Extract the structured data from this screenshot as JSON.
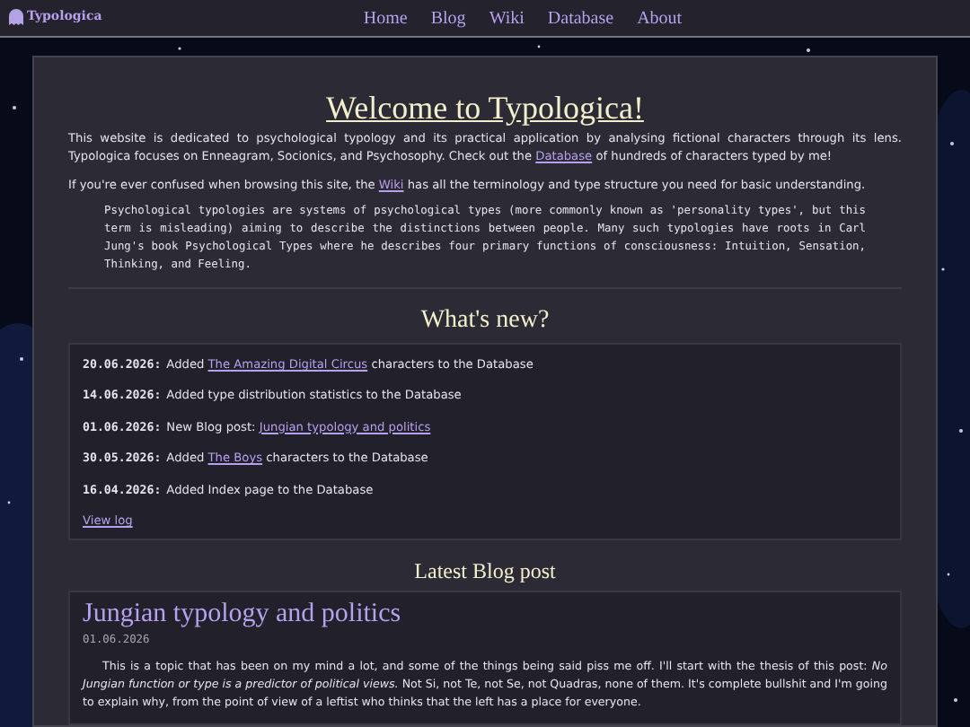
{
  "site": {
    "logo_text": "Typologica"
  },
  "nav": [
    {
      "label": "Home"
    },
    {
      "label": "Blog"
    },
    {
      "label": "Wiki"
    },
    {
      "label": "Database"
    },
    {
      "label": "About"
    }
  ],
  "welcome": {
    "title": "Welcome to Typologica!",
    "intro": {
      "before": "This website is dedicated to psychological typology and its practical application by analysing fictional characters through its lens. Typologica focuses on Enneagram, Socionics, and Psychosophy. Check out the ",
      "link": "Database",
      "after": " of hundreds of characters typed by me!"
    },
    "wiki_note": {
      "before": "If you're ever confused when browsing this site, the ",
      "link": "Wiki",
      "after": " has all the terminology and type structure you need for basic understanding."
    },
    "quote": "Psychological typologies are systems of psychological types (more commonly known as 'personality types', but this term is misleading) aiming to describe the distinctions between people. Many such typologies have roots in Carl Jung's book Psychological Types where he describes four primary functions of consciousness: Intuition, Sensation, Thinking, and Feeling."
  },
  "news": {
    "title": "What's new?",
    "items": [
      {
        "date": "20.06.2026:",
        "before": "Added ",
        "link": "The Amazing Digital Circus",
        "after": " characters to the Database"
      },
      {
        "date": "14.06.2026:",
        "before": "Added type distribution statistics to the Database"
      },
      {
        "date": "01.06.2026:",
        "before": "New Blog post: ",
        "link": "Jungian typology and politics"
      },
      {
        "date": "30.05.2026:",
        "before": "Added ",
        "link": "The Boys",
        "after": " characters to the Database"
      },
      {
        "date": "16.04.2026:",
        "before": "Added Index page to the Database"
      }
    ],
    "view_log": "View log"
  },
  "blog": {
    "title": "Latest Blog post",
    "post_title": "Jungian typology and politics",
    "date": "01.06.2026",
    "body": "This is a topic that has been on my mind a lot, and some of the things being said piss me off. I'll start with the thesis of this post: *No Jungian function or type is a predictor of political views.* Not Si, not Te, not Se, not Quadras, none of them. It's complete bullshit and I'm going to explain why, from the point of view of a leftist who thinks that the left has a place for everyone."
  }
}
